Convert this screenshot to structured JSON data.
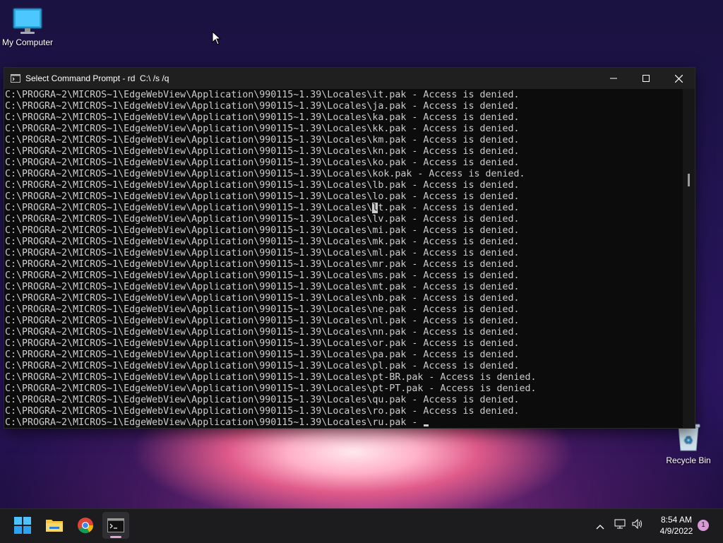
{
  "desktop": {
    "icons": [
      {
        "label": "My Computer",
        "icon": "monitor-icon"
      },
      {
        "label": "Recycle Bin",
        "icon": "recycle-bin-icon"
      }
    ]
  },
  "window": {
    "title": "Select Command Prompt - rd  C:\\ /s /q",
    "controls": [
      "minimize",
      "maximize",
      "close"
    ]
  },
  "console": {
    "lines": [
      "C:\\PROGRA~2\\MICROS~1\\EdgeWebView\\Application\\990115~1.39\\Locales\\it.pak - Access is denied.",
      "C:\\PROGRA~2\\MICROS~1\\EdgeWebView\\Application\\990115~1.39\\Locales\\ja.pak - Access is denied.",
      "C:\\PROGRA~2\\MICROS~1\\EdgeWebView\\Application\\990115~1.39\\Locales\\ka.pak - Access is denied.",
      "C:\\PROGRA~2\\MICROS~1\\EdgeWebView\\Application\\990115~1.39\\Locales\\kk.pak - Access is denied.",
      "C:\\PROGRA~2\\MICROS~1\\EdgeWebView\\Application\\990115~1.39\\Locales\\km.pak - Access is denied.",
      "C:\\PROGRA~2\\MICROS~1\\EdgeWebView\\Application\\990115~1.39\\Locales\\kn.pak - Access is denied.",
      "C:\\PROGRA~2\\MICROS~1\\EdgeWebView\\Application\\990115~1.39\\Locales\\ko.pak - Access is denied.",
      "C:\\PROGRA~2\\MICROS~1\\EdgeWebView\\Application\\990115~1.39\\Locales\\kok.pak - Access is denied.",
      "C:\\PROGRA~2\\MICROS~1\\EdgeWebView\\Application\\990115~1.39\\Locales\\lb.pak - Access is denied.",
      "C:\\PROGRA~2\\MICROS~1\\EdgeWebView\\Application\\990115~1.39\\Locales\\lo.pak - Access is denied.",
      "C:\\PROGRA~2\\MICROS~1\\EdgeWebView\\Application\\990115~1.39\\Locales\\lt.pak - Access is denied.",
      "C:\\PROGRA~2\\MICROS~1\\EdgeWebView\\Application\\990115~1.39\\Locales\\lv.pak - Access is denied.",
      "C:\\PROGRA~2\\MICROS~1\\EdgeWebView\\Application\\990115~1.39\\Locales\\mi.pak - Access is denied.",
      "C:\\PROGRA~2\\MICROS~1\\EdgeWebView\\Application\\990115~1.39\\Locales\\mk.pak - Access is denied.",
      "C:\\PROGRA~2\\MICROS~1\\EdgeWebView\\Application\\990115~1.39\\Locales\\ml.pak - Access is denied.",
      "C:\\PROGRA~2\\MICROS~1\\EdgeWebView\\Application\\990115~1.39\\Locales\\mr.pak - Access is denied.",
      "C:\\PROGRA~2\\MICROS~1\\EdgeWebView\\Application\\990115~1.39\\Locales\\ms.pak - Access is denied.",
      "C:\\PROGRA~2\\MICROS~1\\EdgeWebView\\Application\\990115~1.39\\Locales\\mt.pak - Access is denied.",
      "C:\\PROGRA~2\\MICROS~1\\EdgeWebView\\Application\\990115~1.39\\Locales\\nb.pak - Access is denied.",
      "C:\\PROGRA~2\\MICROS~1\\EdgeWebView\\Application\\990115~1.39\\Locales\\ne.pak - Access is denied.",
      "C:\\PROGRA~2\\MICROS~1\\EdgeWebView\\Application\\990115~1.39\\Locales\\nl.pak - Access is denied.",
      "C:\\PROGRA~2\\MICROS~1\\EdgeWebView\\Application\\990115~1.39\\Locales\\nn.pak - Access is denied.",
      "C:\\PROGRA~2\\MICROS~1\\EdgeWebView\\Application\\990115~1.39\\Locales\\or.pak - Access is denied.",
      "C:\\PROGRA~2\\MICROS~1\\EdgeWebView\\Application\\990115~1.39\\Locales\\pa.pak - Access is denied.",
      "C:\\PROGRA~2\\MICROS~1\\EdgeWebView\\Application\\990115~1.39\\Locales\\pl.pak - Access is denied.",
      "C:\\PROGRA~2\\MICROS~1\\EdgeWebView\\Application\\990115~1.39\\Locales\\pt-BR.pak - Access is denied.",
      "C:\\PROGRA~2\\MICROS~1\\EdgeWebView\\Application\\990115~1.39\\Locales\\pt-PT.pak - Access is denied.",
      "C:\\PROGRA~2\\MICROS~1\\EdgeWebView\\Application\\990115~1.39\\Locales\\qu.pak - Access is denied.",
      "C:\\PROGRA~2\\MICROS~1\\EdgeWebView\\Application\\990115~1.39\\Locales\\ro.pak - Access is denied.",
      "C:\\PROGRA~2\\MICROS~1\\EdgeWebView\\Application\\990115~1.39\\Locales\\ru.pak - "
    ],
    "selected_line_index": 10,
    "selected_char_index": 65,
    "colors": {
      "background": "#0c0c0c",
      "text": "#cccccc"
    }
  },
  "taskbar": {
    "apps": [
      {
        "name": "Start",
        "icon": "windows-start-icon"
      },
      {
        "name": "File Explorer",
        "icon": "folder-icon"
      },
      {
        "name": "Google Chrome",
        "icon": "chrome-icon"
      },
      {
        "name": "Command Prompt",
        "icon": "terminal-icon",
        "active": true
      }
    ],
    "tray_icons": [
      "chevron-up-icon",
      "network-icon",
      "volume-icon"
    ],
    "time": "8:54 AM",
    "date": "4/9/2022",
    "notification_count": "1"
  }
}
